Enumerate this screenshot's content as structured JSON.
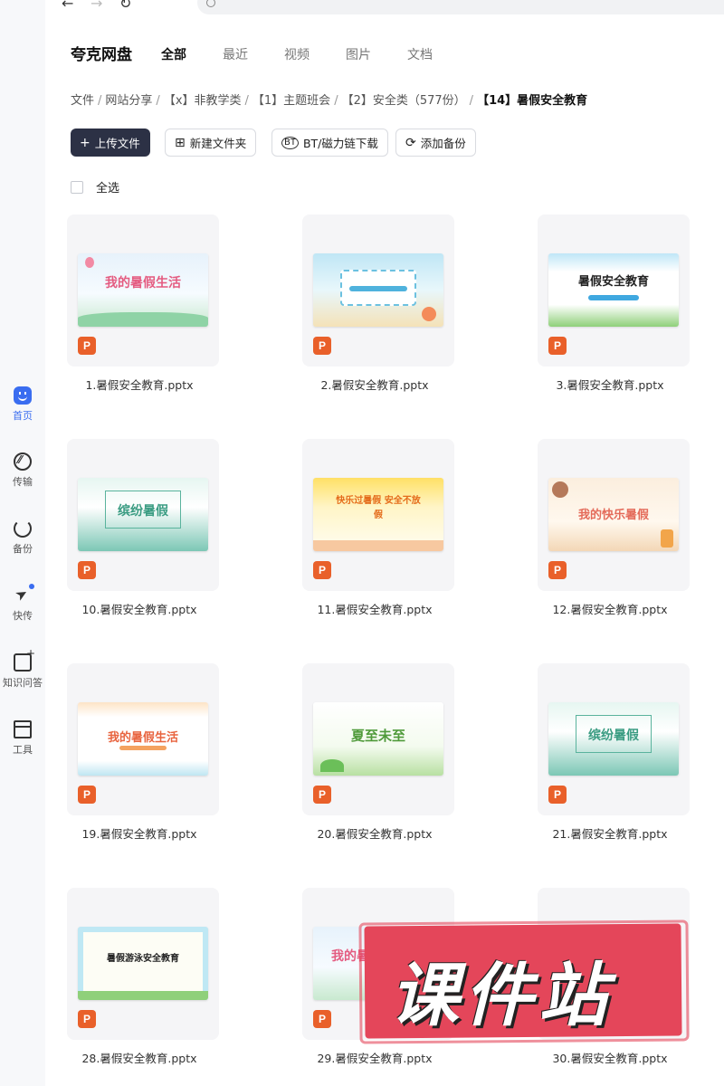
{
  "app": {
    "title": "夸克网盘"
  },
  "tabs": [
    {
      "label": "全部",
      "active": true
    },
    {
      "label": "最近"
    },
    {
      "label": "视频"
    },
    {
      "label": "图片"
    },
    {
      "label": "文档"
    }
  ],
  "sidebar": {
    "items": [
      {
        "label": "首页",
        "icon": "home-icon",
        "active": true
      },
      {
        "label": "传输",
        "icon": "transfer-icon"
      },
      {
        "label": "备份",
        "icon": "backup-icon"
      },
      {
        "label": "快传",
        "icon": "quick-send-icon"
      },
      {
        "label": "知识问答",
        "icon": "qa-icon"
      },
      {
        "label": "工具",
        "icon": "tools-icon"
      }
    ]
  },
  "breadcrumb": [
    "文件",
    "网站分享",
    "【x】非教学类",
    "【1】主题班会",
    "【2】安全类（577份）",
    "【14】暑假安全教育"
  ],
  "toolbar": {
    "upload": "上传文件",
    "new_folder": "新建文件夹",
    "bt": "BT/磁力链下载",
    "backup": "添加备份"
  },
  "select_all": "全选",
  "file_badge": "P",
  "files": [
    {
      "name": "1.暑假安全教育.pptx",
      "thumb_text": "我的暑假生活"
    },
    {
      "name": "2.暑假安全教育.pptx",
      "thumb_text": ""
    },
    {
      "name": "3.暑假安全教育.pptx",
      "thumb_text": "暑假安全教育"
    },
    {
      "name": "10.暑假安全教育.pptx",
      "thumb_text": "缤纷暑假"
    },
    {
      "name": "11.暑假安全教育.pptx",
      "thumb_text": "快乐过暑假 安全不放假"
    },
    {
      "name": "12.暑假安全教育.pptx",
      "thumb_text": "我的快乐暑假"
    },
    {
      "name": "19.暑假安全教育.pptx",
      "thumb_text": "我的暑假生活"
    },
    {
      "name": "20.暑假安全教育.pptx",
      "thumb_text": "夏至未至"
    },
    {
      "name": "21.暑假安全教育.pptx",
      "thumb_text": "缤纷暑假"
    },
    {
      "name": "28.暑假安全教育.pptx",
      "thumb_text": "暑假游泳安全教育"
    },
    {
      "name": "29.暑假安全教育.pptx",
      "thumb_text": "我的暑假"
    },
    {
      "name": "30.暑假安全教育.pptx",
      "thumb_text": ""
    }
  ],
  "watermark": "课件站"
}
